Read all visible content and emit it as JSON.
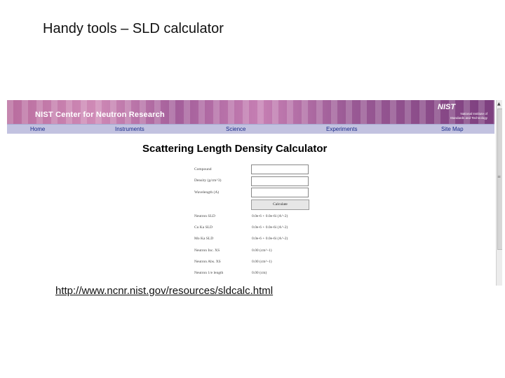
{
  "slide": {
    "title": "Handy tools – SLD calculator",
    "url": "http://www.ncnr.nist.gov/resources/sldcalc.html"
  },
  "banner": {
    "title": "NIST Center for Neutron Research",
    "logo": "NIST",
    "logo_sub_line1": "National Institute of",
    "logo_sub_line2": "Standards and Technology"
  },
  "nav": {
    "items": [
      "Home",
      "Instruments",
      "Science",
      "Experiments",
      "Site Map"
    ]
  },
  "calculator": {
    "title": "Scattering Length Density Calculator",
    "fields": [
      {
        "label": "Compound",
        "value": ""
      },
      {
        "label": "Density (g/cm^3)",
        "value": ""
      },
      {
        "label": "Wavelength (A)",
        "value": ""
      }
    ],
    "button_label": "Calculate",
    "results": [
      {
        "label": "Neutron SLD",
        "value": "0.0e-6 + 0.0e-6i (A^-2)"
      },
      {
        "label": "Cu Ka SLD",
        "value": "0.0e-6 + 0.0e-6i (A^-2)"
      },
      {
        "label": "Mo Ka SLD",
        "value": "0.0e-6 + 0.0e-6i (A^-2)"
      },
      {
        "label": "Neutron Inc. XS",
        "value": "0.00 (cm^-1)"
      },
      {
        "label": "Neutron Abs. XS",
        "value": "0.00 (cm^-1)"
      },
      {
        "label": "Neutron 1/e length",
        "value": "0.00 (cm)"
      }
    ]
  },
  "colors": {
    "banner": "#b86c9e",
    "navbar": "#c2c2e0",
    "nav_text": "#1a2a8a"
  }
}
